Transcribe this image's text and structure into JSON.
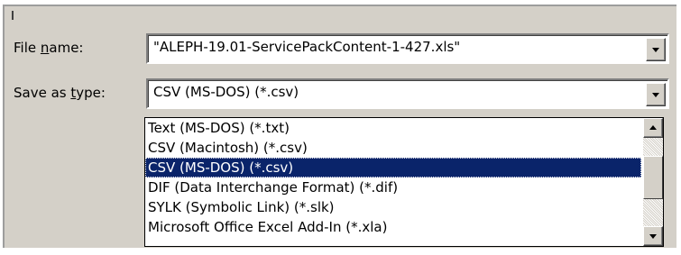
{
  "dialog": {
    "file_name_label": "File name:",
    "save_as_type_label": "Save as type:",
    "file_name_value": "\"ALEPH-19.01-ServicePackContent-1-427.xls\"",
    "save_as_type_value": "CSV (MS-DOS) (*.csv)"
  },
  "type_dropdown": {
    "items": [
      "Text (MS-DOS) (*.txt)",
      "CSV (Macintosh) (*.csv)",
      "CSV (MS-DOS) (*.csv)",
      "DIF (Data Interchange Format) (*.dif)",
      "SYLK (Symbolic Link) (*.slk)",
      "Microsoft Office Excel Add-In (*.xla)"
    ],
    "selected_index": 2
  },
  "colors": {
    "dialog_bg": "#d4d0c8",
    "selection_bg": "#0a246a",
    "selection_fg": "#ffffff"
  },
  "icons": [
    "chevron-down-icon",
    "scroll-up-icon",
    "scroll-down-icon"
  ]
}
